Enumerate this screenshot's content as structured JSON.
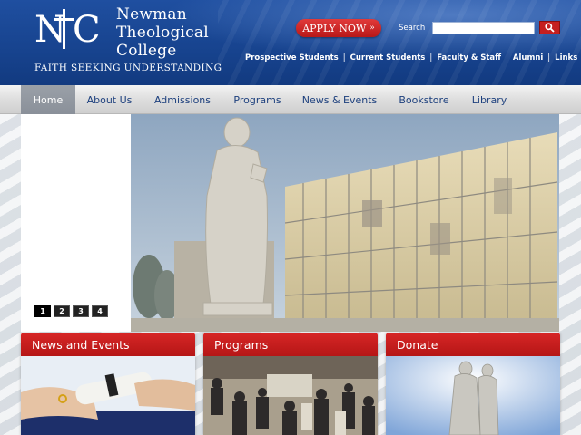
{
  "header": {
    "logo_letters": "NTC",
    "college_name": [
      "Newman",
      "Theological",
      "College"
    ],
    "tagline": "FAITH SEEKING UNDERSTANDING",
    "apply_label": "APPLY NOW",
    "apply_chevron": "»",
    "search_label": "Search",
    "search_value": "",
    "search_icon": "magnifier-icon",
    "top_links": [
      "Prospective Students",
      "Current Students",
      "Faculty & Staff",
      "Alumni",
      "Links"
    ],
    "link_separator": "|"
  },
  "nav": {
    "items": [
      "Home",
      "About Us",
      "Admissions",
      "Programs",
      "News & Events",
      "Bookstore",
      "Library"
    ],
    "active_index": 0
  },
  "slider": {
    "pages": [
      "1",
      "2",
      "3",
      "4"
    ],
    "active_page": "1"
  },
  "features": [
    {
      "title": "News and Events",
      "image": "diploma-handshake-photo"
    },
    {
      "title": "Programs",
      "image": "crowd-event-photo"
    },
    {
      "title": "Donate",
      "image": "saint-statue-photo"
    }
  ],
  "colors": {
    "brand_blue": "#17438e",
    "accent_red": "#c51f1f",
    "nav_text": "#1c3f7d"
  }
}
